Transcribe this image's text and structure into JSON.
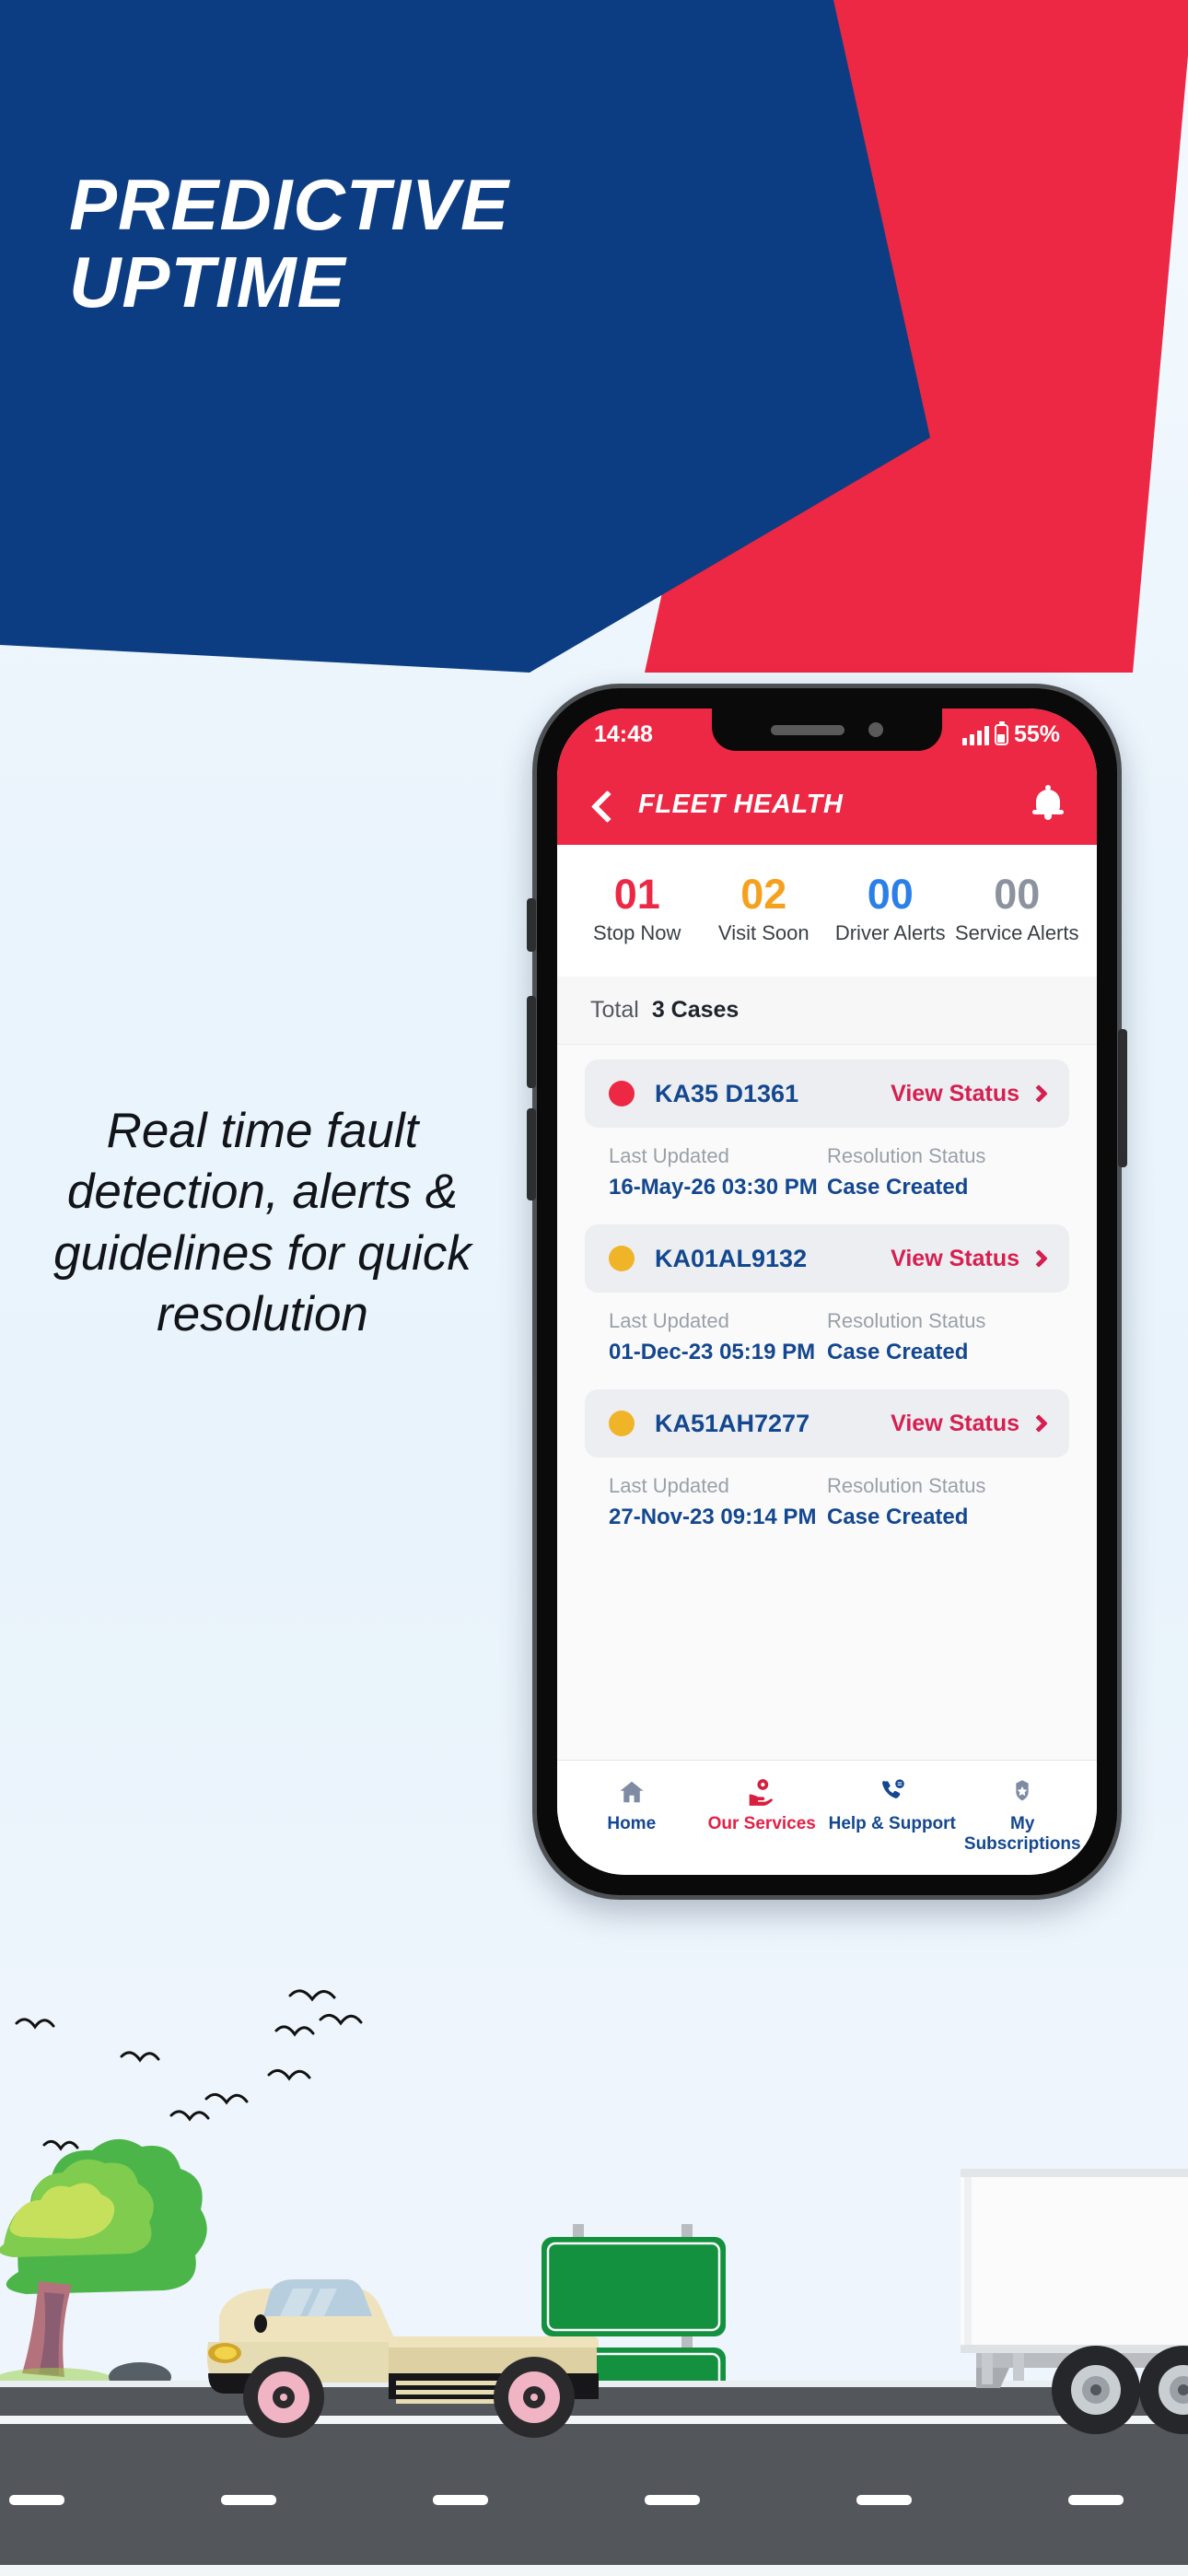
{
  "banner": {
    "headline": "PREDICTIVE\nUPTIME",
    "blue_color": "#0c3d83",
    "red_color": "#ec2844"
  },
  "tagline": "Real time fault detection, alerts & guidelines for quick resolution",
  "phone": {
    "status_bar": {
      "time": "14:48",
      "battery": "55%"
    },
    "app_bar": {
      "title": "FLEET HEALTH",
      "back_icon": "chevron-left-icon",
      "bell_icon": "notification-bell-icon"
    },
    "stats": [
      {
        "num": "01",
        "label": "Stop Now",
        "color": "#ec2844"
      },
      {
        "num": "02",
        "label": "Visit Soon",
        "color": "#f5a11e"
      },
      {
        "num": "00",
        "label": "Driver Alerts",
        "color": "#2a7fe8"
      },
      {
        "num": "00",
        "label": "Service Alerts",
        "color": "#8c939e"
      }
    ],
    "total": {
      "key": "Total",
      "value": "3 Cases"
    },
    "cases": [
      {
        "plate": "KA35 D1361",
        "severity_color": "#ec2844",
        "action": "View Status",
        "updated_label": "Last Updated",
        "updated_value": "16-May-26 03:30 PM",
        "status_label": "Resolution Status",
        "status_value": "Case Created"
      },
      {
        "plate": "KA01AL9132",
        "severity_color": "#f0b429",
        "action": "View Status",
        "updated_label": "Last Updated",
        "updated_value": "01-Dec-23 05:19 PM",
        "status_label": "Resolution Status",
        "status_value": "Case Created"
      },
      {
        "plate": "KA51AH7277",
        "severity_color": "#f0b429",
        "action": "View Status",
        "updated_label": "Last Updated",
        "updated_value": "27-Nov-23 09:14 PM",
        "status_label": "Resolution Status",
        "status_value": "Case Created"
      }
    ],
    "tabs": [
      {
        "label": "Home",
        "icon": "home-icon",
        "active": false
      },
      {
        "label": "Our Services",
        "icon": "service-hand-icon",
        "active": true
      },
      {
        "label": "Help & Support",
        "icon": "phone-support-icon",
        "active": false
      },
      {
        "label": "My Subscriptions",
        "icon": "badge-star-icon",
        "active": false
      }
    ],
    "colors": {
      "accent_red": "#ec2844",
      "navy": "#13478f",
      "inactive": "#7e8ba3"
    }
  },
  "scene": {
    "road_color": "#53565b",
    "sign_color": "#13913f",
    "tree_color": "#3fb045",
    "truck_color": "#e2d6a8",
    "trailer_color": "#f2f2f2"
  }
}
